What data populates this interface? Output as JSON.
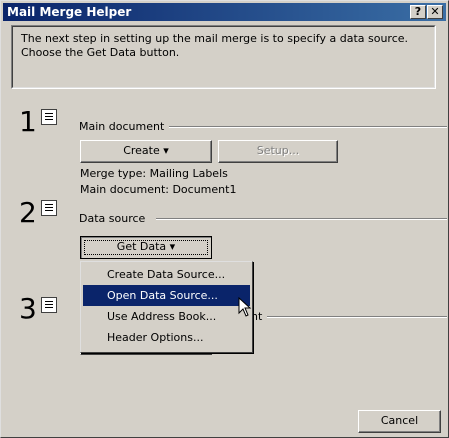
{
  "window": {
    "title": "Mail Merge Helper",
    "help_button": "?",
    "close_button": "✕"
  },
  "instruction": "The next step in setting up the mail merge is to specify a data source. Choose the Get Data button.",
  "steps": [
    {
      "number": "1",
      "label": "Main document"
    },
    {
      "number": "2",
      "label": "Data source"
    },
    {
      "number": "3",
      "label_fragment": "nt"
    }
  ],
  "main_document": {
    "create_button": "Create ▾",
    "setup_button": "Setup...",
    "merge_type": "Merge type: Mailing Labels",
    "main_document_line": "Main document: Document1"
  },
  "data_source": {
    "get_data_button": "Get Data ▾"
  },
  "get_data_menu": {
    "items": [
      "Create Data Source...",
      "Open Data Source...",
      "Use Address Book...",
      "Header Options..."
    ],
    "highlighted_index": 1
  },
  "cancel_button": "Cancel"
}
